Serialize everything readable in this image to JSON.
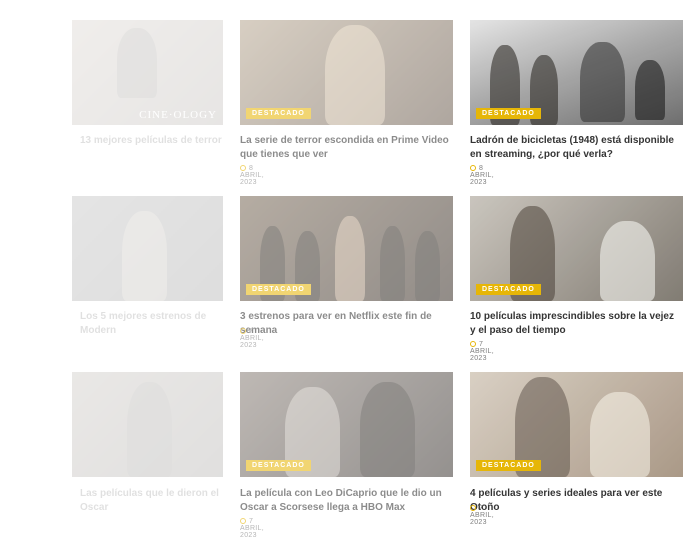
{
  "badge_label": "DESTACADO",
  "articles": [
    {
      "title": "13 mejores películas de terror",
      "date": "",
      "has_badge": false,
      "watermark": "CINE·OLOGY"
    },
    {
      "title": "La serie de terror escondida en Prime Video que tienes que ver",
      "date": "8 ABRIL, 2023",
      "has_badge": true
    },
    {
      "title": "Ladrón de bicicletas (1948) está disponible en streaming, ¿por qué verla?",
      "date": "8 ABRIL, 2023",
      "has_badge": true
    },
    {
      "title": "Los 5 mejores estrenos de Modern",
      "date": "",
      "has_badge": false
    },
    {
      "title": "3 estrenos para ver en Netflix este fin de semana",
      "date": "7 ABRIL, 2023",
      "has_badge": true
    },
    {
      "title": "10 películas imprescindibles sobre la vejez y el paso del tiempo",
      "date": "7 ABRIL, 2023",
      "has_badge": true
    },
    {
      "title": "Las películas que le dieron el Oscar",
      "date": "",
      "has_badge": false
    },
    {
      "title": "La película con Leo DiCaprio que le dio un Oscar a Scorsese llega a HBO Max",
      "date": "7 ABRIL, 2023",
      "has_badge": true
    },
    {
      "title": "4 películas y series ideales para ver este Otoño",
      "date": "7 ABRIL, 2023",
      "has_badge": true
    }
  ]
}
